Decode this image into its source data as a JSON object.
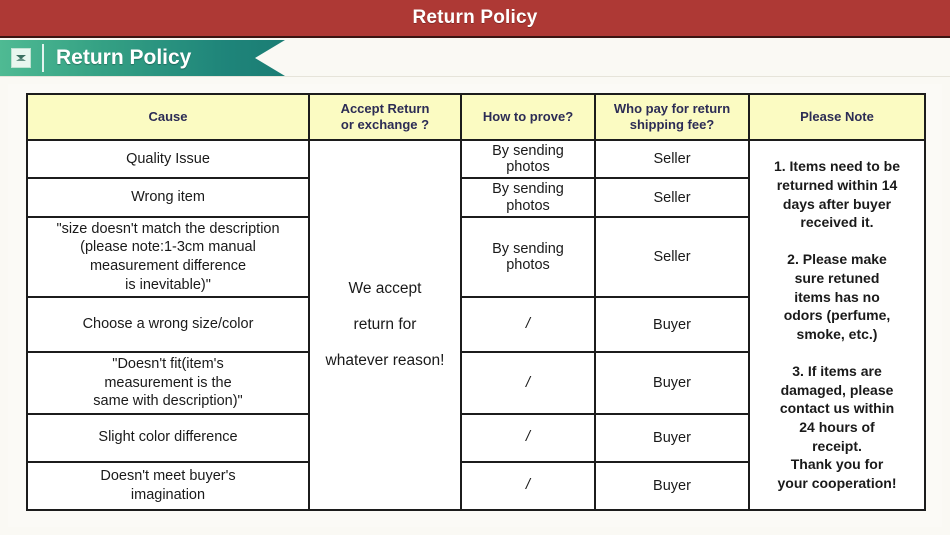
{
  "titlebar": {
    "title": "Return Policy"
  },
  "banner": {
    "icon": "envelope-arrow-icon",
    "icon_glyph": "✉",
    "label": "Return Policy"
  },
  "colors": {
    "header_red": "#ae3935",
    "banner_green_light": "#4fba93",
    "banner_green_dark": "#1b7d74",
    "table_header_yellow": "#fbfbc2",
    "table_header_text": "#2c2c55",
    "table_border": "#1c1c1c",
    "page_background": "#faf9f4"
  },
  "table": {
    "headers": [
      "Cause",
      "Accept Return\nor exchange ?",
      "How to prove?",
      "Who pay for return\nshipping fee?",
      "Please Note"
    ],
    "header_cause": "Cause",
    "header_accept_line1": "Accept Return",
    "header_accept_line2": "or exchange ?",
    "header_prove": "How to prove?",
    "header_who_line1": "Who pay for return",
    "header_who_line2": "shipping fee?",
    "header_note": "Please Note",
    "accept_merged": {
      "line1": "We accept",
      "line2": "return for",
      "line3": "whatever reason!"
    },
    "rows": [
      {
        "cause": "Quality Issue",
        "prove_line1": "By sending",
        "prove_line2": "photos",
        "who": "Seller"
      },
      {
        "cause": "Wrong item",
        "prove_line1": "By sending",
        "prove_line2": "photos",
        "who": "Seller"
      },
      {
        "cause": "\"size doesn't match the description\n(please note:1-3cm manual\nmeasurement difference\nis inevitable)\"",
        "prove_line1": "By sending",
        "prove_line2": "photos",
        "who": "Seller"
      },
      {
        "cause": "Choose a wrong size/color",
        "prove_line1": "/",
        "prove_line2": "",
        "who": "Buyer"
      },
      {
        "cause": "\"Doesn't fit(item's\nmeasurement is the\nsame with description)\"",
        "prove_line1": "/",
        "prove_line2": "",
        "who": "Buyer"
      },
      {
        "cause": "Slight color difference",
        "prove_line1": "/",
        "prove_line2": "",
        "who": "Buyer"
      },
      {
        "cause": "Doesn't meet buyer's\nimagination",
        "prove_line1": "/",
        "prove_line2": "",
        "who": "Buyer"
      }
    ],
    "note": "1. Items need to be\nreturned within 14\ndays after buyer\nreceived it.\n\n2. Please make\nsure retuned\nitems has no\nodors (perfume,\nsmoke, etc.)\n\n3. If items are\ndamaged, please\ncontact us within\n24 hours of\nreceipt.\nThank you for\nyour cooperation!"
  }
}
